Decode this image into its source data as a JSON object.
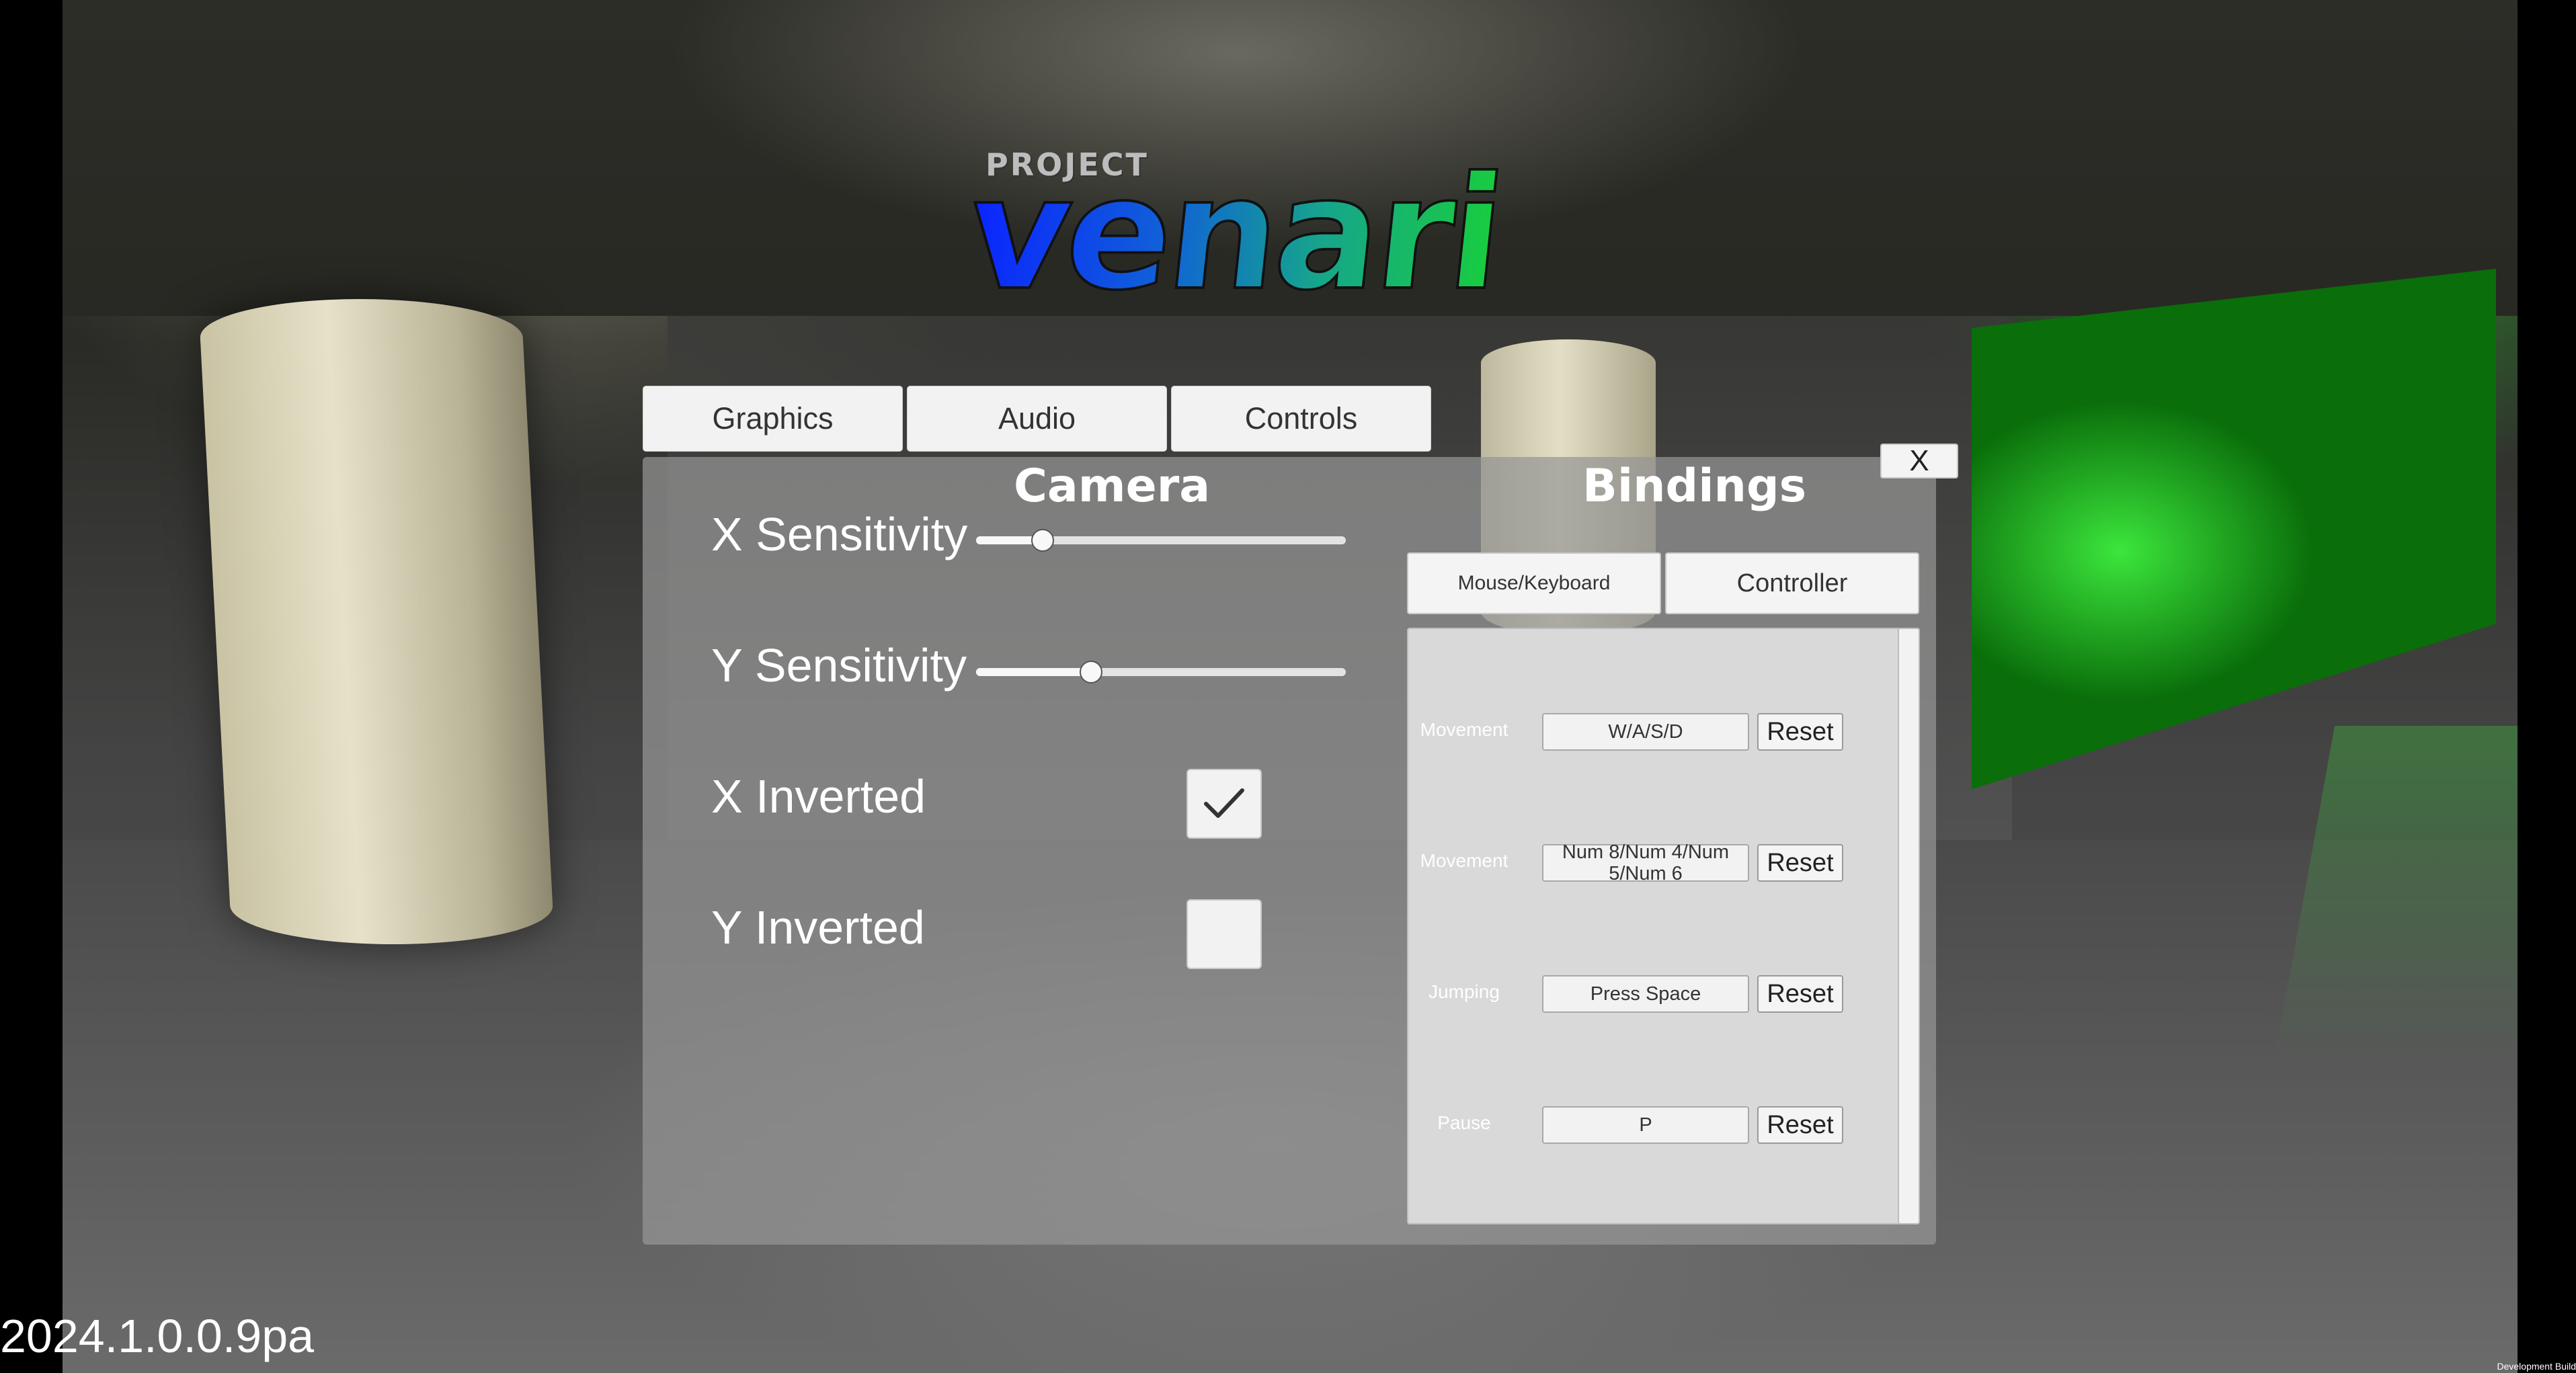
{
  "logo": {
    "project": "PROJECT",
    "name": "venari"
  },
  "tabs": [
    {
      "label": "Graphics"
    },
    {
      "label": "Audio"
    },
    {
      "label": "Controls"
    }
  ],
  "close_label": "X",
  "camera": {
    "title": "Camera",
    "x_sensitivity": {
      "label": "X Sensitivity",
      "value_fraction": 0.18
    },
    "y_sensitivity": {
      "label": "Y Sensitivity",
      "value_fraction": 0.31
    },
    "x_inverted": {
      "label": "X Inverted",
      "checked": true
    },
    "y_inverted": {
      "label": "Y Inverted",
      "checked": false
    }
  },
  "bindings": {
    "title": "Bindings",
    "tabs": [
      {
        "label": "Mouse/Keyboard"
      },
      {
        "label": "Controller"
      }
    ],
    "rows": [
      {
        "action": "Movement",
        "key": "W/A/S/D",
        "reset": "Reset"
      },
      {
        "action": "Movement",
        "key": "Num 8/Num 4/Num 5/Num 6",
        "reset": "Reset"
      },
      {
        "action": "Jumping",
        "key": "Press Space",
        "reset": "Reset"
      },
      {
        "action": "Pause",
        "key": "P",
        "reset": "Reset"
      }
    ]
  },
  "version": "2024.1.0.0.9pa",
  "dev_build": "Development Build",
  "colors": {
    "panel": "#969696",
    "green_light": "#19d234",
    "logo_blue": "#0b24ff"
  }
}
